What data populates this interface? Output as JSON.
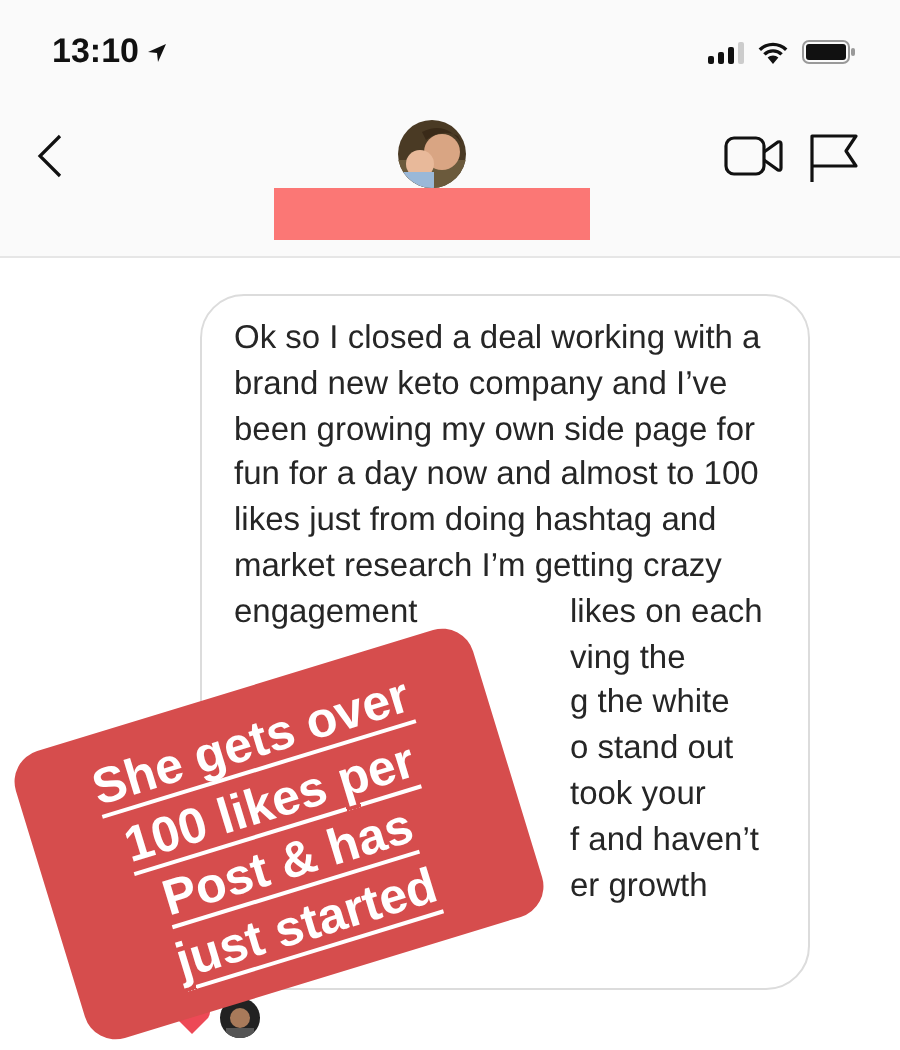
{
  "status_bar": {
    "time": "13:10"
  },
  "message": {
    "lines": [
      {
        "left": "Ok so I closed a deal working with a"
      },
      {
        "left": "brand new keto company and I’ve"
      },
      {
        "left": "been growing my own side page for"
      },
      {
        "left": "fun for a day now and almost to 100"
      },
      {
        "left": "likes just from doing hashtag and"
      },
      {
        "left": "market research I’m getting crazy"
      },
      {
        "left": "engagement",
        "right": "likes on each"
      },
      {
        "right": "ving the"
      },
      {
        "right": "g the white"
      },
      {
        "right": "o stand out"
      },
      {
        "right": "took your"
      },
      {
        "right": "f and haven’t"
      },
      {
        "right": "er growth"
      }
    ]
  },
  "sticker": {
    "lines": [
      "She gets over",
      "100 likes per",
      "Post & has",
      "just started"
    ]
  }
}
